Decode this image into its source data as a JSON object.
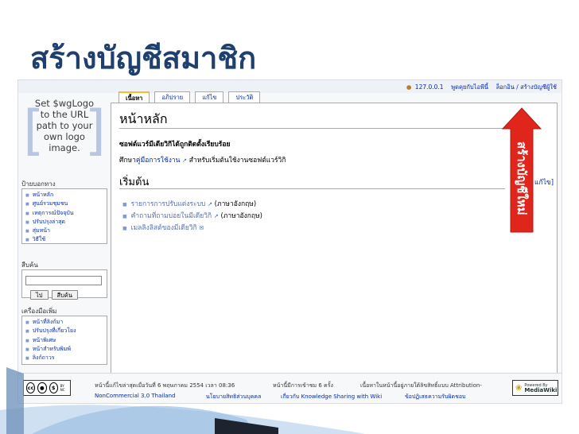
{
  "slide_title": "สร้างบัญชีสมาชิก",
  "callout": {
    "label": "สร้างบัญชีใหม่",
    "color": "#e0261c"
  },
  "personal_tools": {
    "ip": "127.0.0.1",
    "talk": "พูดคุยกับไอพีนี้",
    "login": "ล็อกอิน / สร้างบัญชีผู้ใช้"
  },
  "logo": {
    "lines": [
      "Set $wgLogo",
      "to the URL",
      "path to your",
      "own logo",
      "image."
    ]
  },
  "tabs": [
    {
      "label": "เนื้อหา",
      "selected": true
    },
    {
      "label": "อภิปราย",
      "selected": false
    },
    {
      "label": "แก้ไข",
      "selected": false
    },
    {
      "label": "ประวัติ",
      "selected": false
    }
  ],
  "page": {
    "heading": "หน้าหลัก",
    "install_msg": "ซอฟต์แวร์มีเดียวิกิได้ถูกติดตั้งเรียบร้อย",
    "guide_prefix": "ศึกษา",
    "guide_link": "คู่มือการใช้งาน",
    "guide_suffix": "สำหรับเริ่มต้นใช้งานซอฟต์แวร์วิกิ",
    "section_heading": "เริ่มต้น",
    "section_edit": "แก้ไข]",
    "start_items": [
      {
        "link": "รายการการปรับแต่งระบบ",
        "note": "(ภาษาอังกฤษ)"
      },
      {
        "link": "คำถามที่ถามบ่อยในมีเดียวิกิ",
        "note": "(ภาษาอังกฤษ)"
      },
      {
        "link": "เมลลิงลิสต์ของมีเดียวิกิ",
        "note": ""
      }
    ]
  },
  "navigation": {
    "title": "ป้ายบอกทาง",
    "items": [
      "หน้าหลัก",
      "ศูนย์รวมชุมชน",
      "เหตุการณ์ปัจจุบัน",
      "ปรับปรุงล่าสุด",
      "สุ่มหน้า",
      "วิธีใช้"
    ]
  },
  "search": {
    "title": "สืบค้น",
    "placeholder": "",
    "go_label": "ไป",
    "search_label": "สืบค้น"
  },
  "toolbox": {
    "title": "เครื่องมือเพิ่ม",
    "items": [
      "หน้าที่ลิงก์มา",
      "ปรับปรุงที่เกี่ยวโยง",
      "หน้าพิเศษ",
      "หน้าสำหรับพิมพ์",
      "ลิงก์ถาวร"
    ]
  },
  "footer": {
    "cc_sub": "BY   NC",
    "last_modified": "หน้านี้แก้ไขล่าสุดเมื่อวันที่ 6 พฤษภาคม 2554 เวลา 08:36",
    "views": "หน้านี้มีการเข้าชม 6 ครั้ง",
    "license": "เนื้อหาในหน้านี้อยู่ภายใต้ลิขสิทธิ์แบบ Attribution-",
    "license_cont": "NonCommercial 3.0 Thailand",
    "privacy": "นโยบายสิทธิส่วนบุคคล",
    "about": "เกี่ยวกับ Knowledge Sharing with Wiki",
    "disclaimer": "ข้อปฏิเสธความรับผิดชอบ",
    "mw_powered": "Powered By",
    "mw_name": "MediaWiki"
  }
}
